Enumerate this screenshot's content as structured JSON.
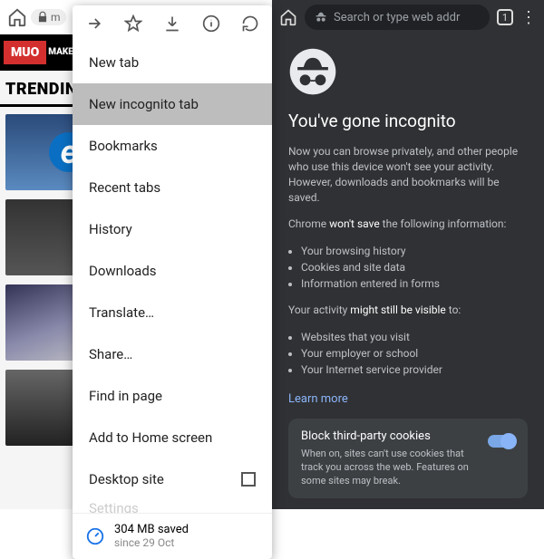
{
  "left": {
    "url_fragment": "m",
    "brand_logo": "MUO",
    "brand_tag": "MAKE\nUSE\nOF",
    "trending_label": "TRENDIN",
    "menu": {
      "items": [
        "New tab",
        "New incognito tab",
        "Bookmarks",
        "Recent tabs",
        "History",
        "Downloads",
        "Translate…",
        "Share…",
        "Find in page",
        "Add to Home screen",
        "Desktop site"
      ],
      "highlighted_index": 1,
      "desktop_site_checked": false,
      "cutoff": "Settings"
    },
    "data_saver": {
      "amount": "304 MB saved",
      "since": "since 29 Oct"
    }
  },
  "right": {
    "search_placeholder": "Search or type web addr",
    "tab_count": "1",
    "title": "You've gone incognito",
    "intro": "Now you can browse privately, and other people who use this device won't see your activity. However, downloads and bookmarks will be saved.",
    "wont_save_prefix": "Chrome ",
    "wont_save_strong": "won't save",
    "wont_save_suffix": " the following information:",
    "wont_save_list": [
      "Your browsing history",
      "Cookies and site data",
      "Information entered in forms"
    ],
    "visible_prefix": "Your activity ",
    "visible_strong": "might still be visible",
    "visible_suffix": " to:",
    "visible_list": [
      "Websites that you visit",
      "Your employer or school",
      "Your Internet service provider"
    ],
    "learn_more": "Learn more",
    "cookie_title": "Block third-party cookies",
    "cookie_desc": "When on, sites can't use cookies that track you across the web. Features on some sites may break."
  }
}
